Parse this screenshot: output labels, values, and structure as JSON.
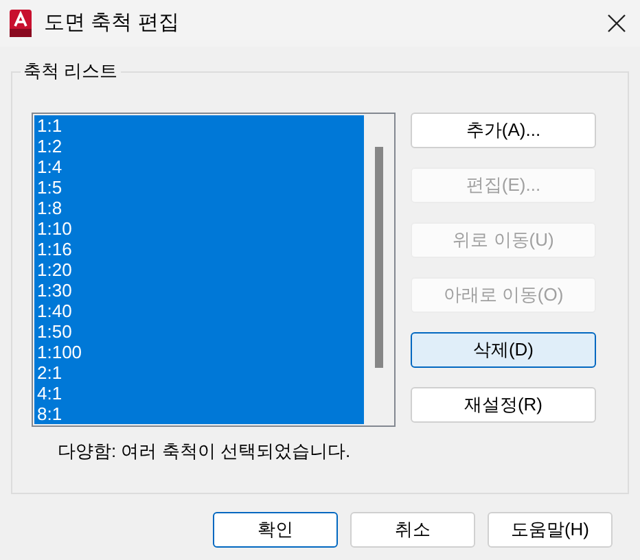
{
  "window": {
    "title": "도면 축척 편집"
  },
  "group": {
    "label": "축척 리스트"
  },
  "scales": [
    {
      "label": "1:1",
      "selected": true
    },
    {
      "label": "1:2",
      "selected": true
    },
    {
      "label": "1:4",
      "selected": true
    },
    {
      "label": "1:5",
      "selected": true
    },
    {
      "label": "1:8",
      "selected": true
    },
    {
      "label": "1:10",
      "selected": true
    },
    {
      "label": "1:16",
      "selected": true
    },
    {
      "label": "1:20",
      "selected": true
    },
    {
      "label": "1:30",
      "selected": true
    },
    {
      "label": "1:40",
      "selected": true
    },
    {
      "label": "1:50",
      "selected": true
    },
    {
      "label": "1:100",
      "selected": true
    },
    {
      "label": "2:1",
      "selected": true
    },
    {
      "label": "4:1",
      "selected": true
    },
    {
      "label": "8:1",
      "selected": true
    }
  ],
  "side_buttons": [
    {
      "label": "추가(A)...",
      "disabled": false,
      "focused": false
    },
    {
      "label": "편집(E)...",
      "disabled": true,
      "focused": false
    },
    {
      "label": "위로 이동(U)",
      "disabled": true,
      "focused": false
    },
    {
      "label": "아래로 이동(O)",
      "disabled": true,
      "focused": false
    },
    {
      "label": "삭제(D)",
      "disabled": false,
      "focused": true
    },
    {
      "label": "재설정(R)",
      "disabled": false,
      "focused": false
    }
  ],
  "status": "다양함: 여러 축척이 선택되었습니다.",
  "footer_buttons": [
    {
      "label": "확인",
      "default": true
    },
    {
      "label": "취소",
      "default": false
    },
    {
      "label": "도움말(H)",
      "default": false
    }
  ]
}
